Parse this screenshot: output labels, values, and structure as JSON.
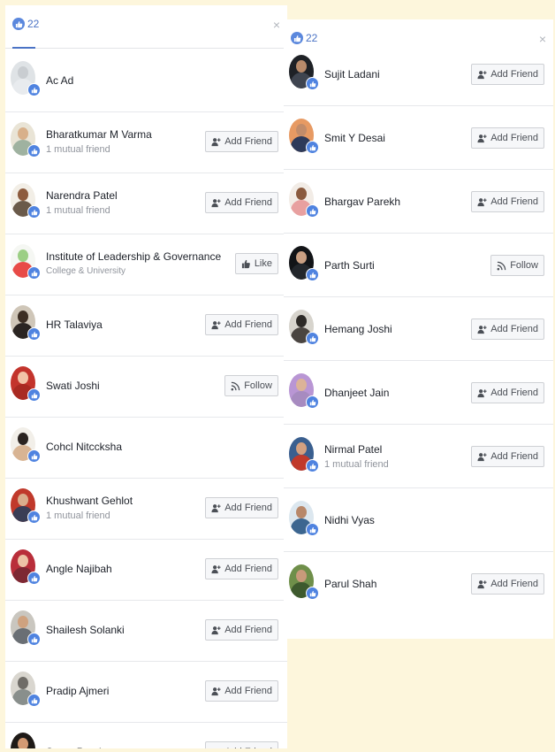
{
  "colors": {
    "accent": "#4b73c5",
    "badge": "#4f83e0",
    "page_bg": "#fdf6dc"
  },
  "left_panel": {
    "count": "22",
    "close_glyph": "×",
    "rows": [
      {
        "name": "Ac Ad",
        "sub": "",
        "button": null,
        "avatar": [
          "#dfe3e6",
          "#c9cdd1",
          "#e8ebee"
        ]
      },
      {
        "name": "Bharatkumar M Varma",
        "sub": "1 mutual friend",
        "button": {
          "label": "Add Friend",
          "icon": "add-friend-icon"
        },
        "avatar": [
          "#e9e4d6",
          "#d8b08a",
          "#9fb2a0"
        ]
      },
      {
        "name": "Narendra Patel",
        "sub": "1 mutual friend",
        "button": {
          "label": "Add Friend",
          "icon": "add-friend-icon"
        },
        "avatar": [
          "#f2eee6",
          "#8d5b3e",
          "#6a5a4a"
        ]
      },
      {
        "name": "Institute of Leadership & Governance",
        "sub": "College & University",
        "button": {
          "label": "Like",
          "icon": "thumbs-up-icon"
        },
        "avatar": [
          "#f5f7f3",
          "#9ccf85",
          "#e84b47"
        ]
      },
      {
        "name": "HR Talaviya",
        "sub": "",
        "button": {
          "label": "Add Friend",
          "icon": "add-friend-icon"
        },
        "avatar": [
          "#cfc6b8",
          "#3c2e23",
          "#2b2522"
        ]
      },
      {
        "name": "Swati Joshi",
        "sub": "",
        "button": {
          "label": "Follow",
          "icon": "rss-icon"
        },
        "avatar": [
          "#c3342c",
          "#f2c4a8",
          "#a92a22"
        ]
      },
      {
        "name": "Cohcl Nitccksha",
        "sub": "",
        "button": null,
        "avatar": [
          "#f2efe9",
          "#2a2320",
          "#d8b493"
        ]
      },
      {
        "name": "Khushwant Gehlot",
        "sub": "1 mutual friend",
        "button": {
          "label": "Add Friend",
          "icon": "add-friend-icon"
        },
        "avatar": [
          "#c0392b",
          "#d9ad8c",
          "#3a3d55"
        ]
      },
      {
        "name": "Angle Najibah",
        "sub": "",
        "button": {
          "label": "Add Friend",
          "icon": "add-friend-icon"
        },
        "avatar": [
          "#b92e3a",
          "#edc3a6",
          "#7d2833"
        ]
      },
      {
        "name": "Shailesh Solanki",
        "sub": "",
        "button": {
          "label": "Add Friend",
          "icon": "add-friend-icon"
        },
        "avatar": [
          "#c9c6bf",
          "#cfa27f",
          "#6a6f74"
        ]
      },
      {
        "name": "Pradip Ajmeri",
        "sub": "",
        "button": {
          "label": "Add Friend",
          "icon": "add-friend-icon"
        },
        "avatar": [
          "#d9d6cf",
          "#6f6c67",
          "#898f8c"
        ]
      },
      {
        "name": "Sanat Pandya",
        "sub": "",
        "button": {
          "label": "Add Friend",
          "icon": "add-friend-icon"
        },
        "avatar": [
          "#1e1a17",
          "#d39a73",
          "#2e2a26"
        ]
      }
    ]
  },
  "right_panel": {
    "count": "22",
    "close_glyph": "×",
    "rows": [
      {
        "name": "Sujit Ladani",
        "sub": "",
        "button": {
          "label": "Add Friend",
          "icon": "add-friend-icon"
        },
        "avatar": [
          "#1e2126",
          "#b88a6a",
          "#3f4550"
        ]
      },
      {
        "name": "Smit Y Desai",
        "sub": "",
        "button": {
          "label": "Add Friend",
          "icon": "add-friend-icon"
        },
        "avatar": [
          "#e79a63",
          "#c28c6a",
          "#2d3a5a"
        ]
      },
      {
        "name": "Bhargav Parekh",
        "sub": "",
        "button": {
          "label": "Add Friend",
          "icon": "add-friend-icon"
        },
        "avatar": [
          "#f2ece6",
          "#8a5a3e",
          "#e8a0a0"
        ]
      },
      {
        "name": "Parth Surti",
        "sub": "",
        "button": {
          "label": "Follow",
          "icon": "rss-icon"
        },
        "avatar": [
          "#121417",
          "#caa083",
          "#23272c"
        ]
      },
      {
        "name": "Hemang Joshi",
        "sub": "",
        "button": {
          "label": "Add Friend",
          "icon": "add-friend-icon"
        },
        "avatar": [
          "#d7d4cd",
          "#2d2a27",
          "#4a4541"
        ]
      },
      {
        "name": "Dhanjeet Jain",
        "sub": "",
        "button": {
          "label": "Add Friend",
          "icon": "add-friend-icon"
        },
        "avatar": [
          "#b996d4",
          "#dcb398",
          "#a78bc0"
        ]
      },
      {
        "name": "Nirmal Patel",
        "sub": "1 mutual friend",
        "button": {
          "label": "Add Friend",
          "icon": "add-friend-icon"
        },
        "avatar": [
          "#3a5f8f",
          "#d3a080",
          "#c0392b"
        ]
      },
      {
        "name": "Nidhi Vyas",
        "sub": "",
        "button": null,
        "avatar": [
          "#dce7ef",
          "#b8886a",
          "#3c6690"
        ]
      },
      {
        "name": "Parul Shah",
        "sub": "",
        "button": {
          "label": "Add Friend",
          "icon": "add-friend-icon"
        },
        "avatar": [
          "#6f8f4a",
          "#c89a7a",
          "#3e5a2e"
        ]
      }
    ]
  }
}
